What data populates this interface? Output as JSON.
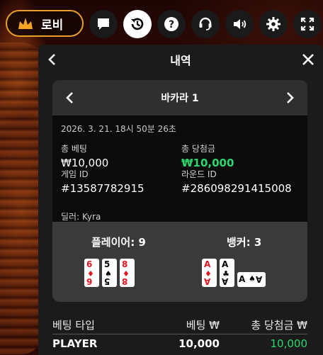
{
  "topbar": {
    "lobby_label": "로비",
    "icons": [
      "chat-icon",
      "history-icon",
      "help-icon",
      "support-icon",
      "sound-icon",
      "settings-icon",
      "fullscreen-icon"
    ]
  },
  "panel": {
    "title": "내역"
  },
  "game": {
    "name": "바카라 1",
    "datetime": "2026. 3. 21. 18시 50분 26초",
    "bet_label": "총 베팅",
    "bet_value": "₩10,000",
    "win_label": "총 당첨금",
    "win_value": "₩10,000",
    "game_id_label": "게임 ID",
    "game_id": "#13587782915",
    "round_id_label": "라운드 ID",
    "round_id": "#286098291415008",
    "dealer": "딜러: Kyra"
  },
  "result": {
    "player_label": "플레이어: 9",
    "banker_label": "뱅커: 3",
    "player_cards": [
      {
        "rank": "6",
        "suit": "♦",
        "color": "red",
        "sideways": false
      },
      {
        "rank": "5",
        "suit": "♠",
        "color": "black",
        "sideways": false
      },
      {
        "rank": "8",
        "suit": "♦",
        "color": "red",
        "sideways": false
      }
    ],
    "banker_cards": [
      {
        "rank": "A",
        "suit": "♦",
        "color": "red",
        "sideways": false
      },
      {
        "rank": "A",
        "suit": "♣",
        "color": "black",
        "sideways": false
      },
      {
        "rank": "A",
        "suit": "♠",
        "color": "black",
        "sideways": true
      }
    ]
  },
  "bets": {
    "headers": [
      "베팅 타입",
      "베팅 ₩",
      "총 당첨금 ₩"
    ],
    "rows": [
      {
        "type": "PLAYER",
        "bet": "10,000",
        "win": "10,000"
      }
    ]
  },
  "colors": {
    "accent": "#e8a02a",
    "win_green": "#2bd66e",
    "panel_bg": "#1b1b1b",
    "card_red": "#e0141e"
  }
}
